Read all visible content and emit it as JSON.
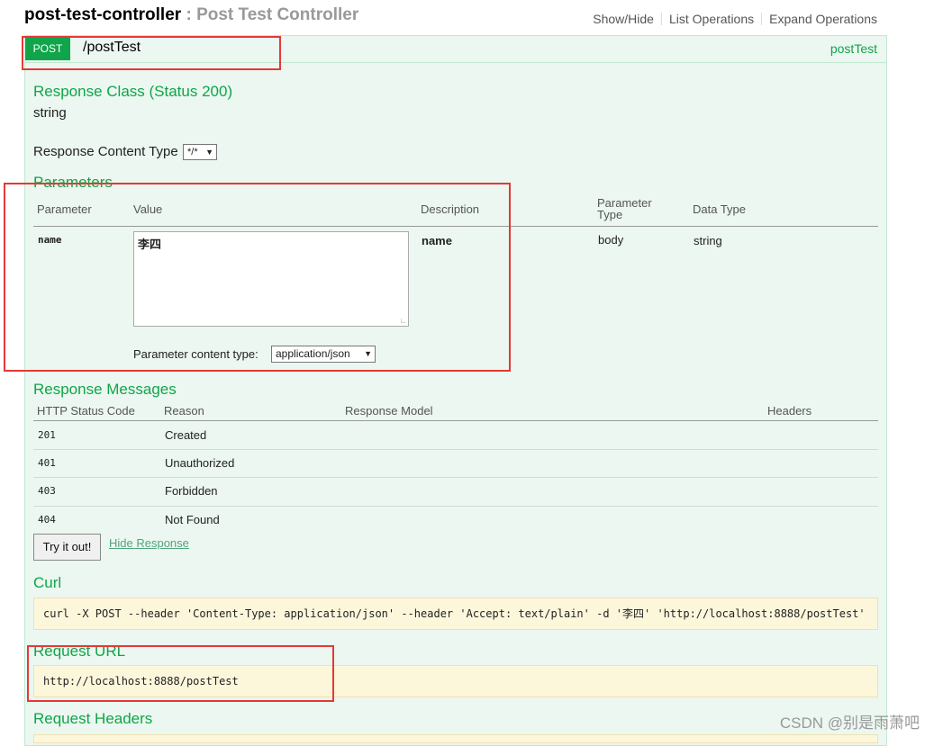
{
  "controller": {
    "name": "post-test-controller",
    "separator": " : ",
    "description": "Post Test Controller",
    "links": [
      "Show/Hide",
      "List Operations",
      "Expand Operations"
    ]
  },
  "operation": {
    "method": "POST",
    "path": "/postTest",
    "nickname": "postTest"
  },
  "response_class": {
    "heading": "Response Class (Status 200)",
    "value": "string"
  },
  "response_content_type": {
    "label": "Response Content Type",
    "selected": "*/*"
  },
  "parameters": {
    "heading": "Parameters",
    "columns": [
      "Parameter",
      "Value",
      "Description",
      "Parameter Type",
      "Data Type"
    ],
    "rows": [
      {
        "name": "name",
        "value": "李四",
        "description": "name",
        "param_type": "body",
        "data_type": "string",
        "content_type_label": "Parameter content type:",
        "content_type": "application/json"
      }
    ]
  },
  "response_messages": {
    "heading": "Response Messages",
    "columns": [
      "HTTP Status Code",
      "Reason",
      "Response Model",
      "Headers"
    ],
    "rows": [
      {
        "code": "201",
        "reason": "Created"
      },
      {
        "code": "401",
        "reason": "Unauthorized"
      },
      {
        "code": "403",
        "reason": "Forbidden"
      },
      {
        "code": "404",
        "reason": "Not Found"
      }
    ]
  },
  "actions": {
    "try_label": "Try it out!",
    "hide_label": "Hide Response"
  },
  "curl": {
    "heading": "Curl",
    "command": "curl -X POST --header 'Content-Type: application/json' --header 'Accept: text/plain' -d '李四' 'http://localhost:8888/postTest'"
  },
  "request_url": {
    "heading": "Request URL",
    "value": "http://localhost:8888/postTest"
  },
  "request_headers": {
    "heading": "Request Headers"
  },
  "watermark": "CSDN @别是雨萧吧",
  "colors": {
    "accent": "#10a54a",
    "panel_bg": "#ebf7f0",
    "code_bg": "#fcf6db",
    "highlight": "#e53935"
  }
}
